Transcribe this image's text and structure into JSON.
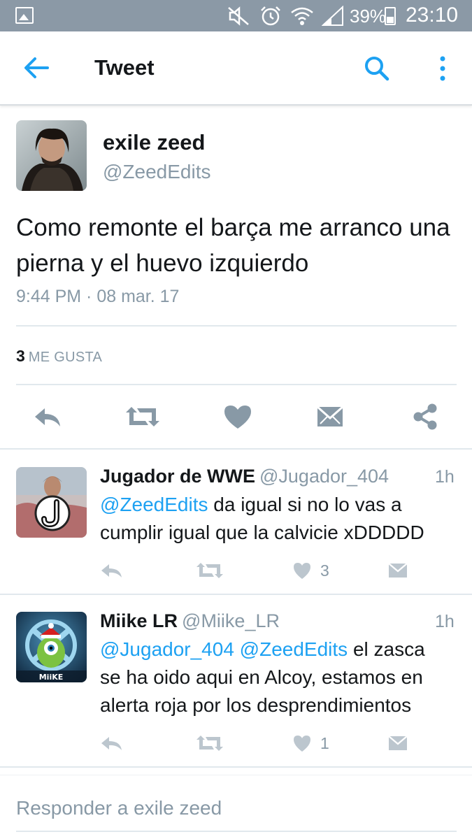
{
  "status_bar": {
    "icons": [
      "gallery-icon",
      "mute-icon",
      "alarm-icon",
      "wifi-icon",
      "signal-icon",
      "battery-icon"
    ],
    "battery": "39%",
    "time": "23:10"
  },
  "app_bar": {
    "title": "Tweet",
    "icons": [
      "back-arrow-icon",
      "search-icon",
      "more-vert-icon"
    ]
  },
  "tweet": {
    "author_name": "exile zeed",
    "author_handle": "@ZeedEdits",
    "text": "Como remonte el barça me arranco una pierna y el huevo izquierdo",
    "timestamp": "9:44 PM · 08 mar. 17",
    "likes_count": "3",
    "likes_label": "ME GUSTA",
    "actions": [
      "reply-icon",
      "retweet-icon",
      "like-icon",
      "direct-message-icon",
      "share-icon"
    ]
  },
  "replies": [
    {
      "name": "Jugador de WWE",
      "handle": "@Jugador_404",
      "age": "1h",
      "mentions": "@ZeedEdits",
      "text": " da igual si no lo vas a cumplir igual que la calvicie xDDDDD",
      "like_count": "3"
    },
    {
      "name": "Miike LR",
      "handle": "@Miike_LR",
      "age": "1h",
      "mentions": "@Jugador_404 @ZeedEdits",
      "text": " el zasca se ha oido aqui en Alcoy, estamos en alerta roja por los desprendimientos",
      "like_count": "1",
      "avatar_label": "MiiKE"
    }
  ],
  "compose": {
    "placeholder": "Responder a exile zeed"
  },
  "colors": {
    "status_bar": "#8b99a6",
    "accent": "#1da1f2",
    "secondary_text": "#8899a6",
    "icon_gray": "#8899a6",
    "divider": "#e1e8ed"
  }
}
